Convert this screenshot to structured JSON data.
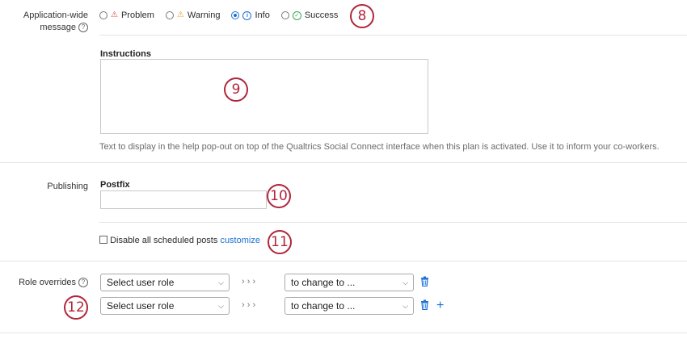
{
  "app_message": {
    "label_line1": "Application-wide",
    "label_line2": "message",
    "options": [
      {
        "label": "Problem",
        "icon": "warning-triangle-red-icon",
        "checked": false
      },
      {
        "label": "Warning",
        "icon": "warning-triangle-orange-icon",
        "checked": false
      },
      {
        "label": "Info",
        "icon": "info-circle-icon",
        "checked": true
      },
      {
        "label": "Success",
        "icon": "check-circle-icon",
        "checked": false
      }
    ]
  },
  "instructions": {
    "title": "Instructions",
    "value": "",
    "hint": "Text to display in the help pop-out on top of the Qualtrics Social Connect interface when this plan is activated. Use it to inform your co-workers."
  },
  "publishing": {
    "label": "Publishing",
    "postfix_title": "Postfix",
    "postfix_value": "",
    "disable_label": "Disable all scheduled posts",
    "customize_link": "customize"
  },
  "role_overrides": {
    "label": "Role overrides",
    "rows": [
      {
        "role_placeholder": "Select user role",
        "change_placeholder": "to change to ..."
      },
      {
        "role_placeholder": "Select user role",
        "change_placeholder": "to change to ..."
      }
    ],
    "arrow_text": "› › ›"
  },
  "markers": [
    "8",
    "9",
    "10",
    "11",
    "12"
  ],
  "colors": {
    "accent": "#1a6fd6",
    "marker": "#b0263a",
    "divider": "#e4e4e4"
  }
}
